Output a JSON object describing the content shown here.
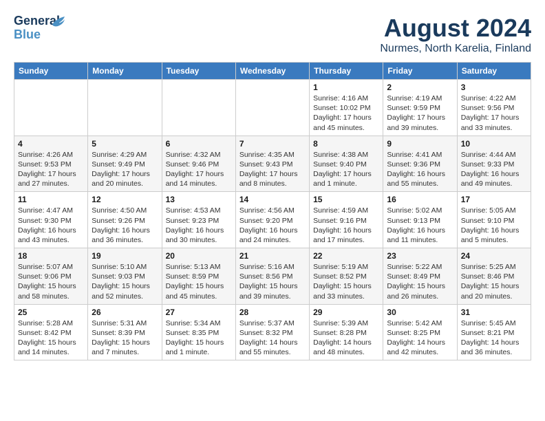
{
  "header": {
    "logo_line1": "General",
    "logo_line2": "Blue",
    "month_year": "August 2024",
    "location": "Nurmes, North Karelia, Finland"
  },
  "weekdays": [
    "Sunday",
    "Monday",
    "Tuesday",
    "Wednesday",
    "Thursday",
    "Friday",
    "Saturday"
  ],
  "weeks": [
    [
      {
        "day": "",
        "info": ""
      },
      {
        "day": "",
        "info": ""
      },
      {
        "day": "",
        "info": ""
      },
      {
        "day": "",
        "info": ""
      },
      {
        "day": "1",
        "info": "Sunrise: 4:16 AM\nSunset: 10:02 PM\nDaylight: 17 hours\nand 45 minutes."
      },
      {
        "day": "2",
        "info": "Sunrise: 4:19 AM\nSunset: 9:59 PM\nDaylight: 17 hours\nand 39 minutes."
      },
      {
        "day": "3",
        "info": "Sunrise: 4:22 AM\nSunset: 9:56 PM\nDaylight: 17 hours\nand 33 minutes."
      }
    ],
    [
      {
        "day": "4",
        "info": "Sunrise: 4:26 AM\nSunset: 9:53 PM\nDaylight: 17 hours\nand 27 minutes."
      },
      {
        "day": "5",
        "info": "Sunrise: 4:29 AM\nSunset: 9:49 PM\nDaylight: 17 hours\nand 20 minutes."
      },
      {
        "day": "6",
        "info": "Sunrise: 4:32 AM\nSunset: 9:46 PM\nDaylight: 17 hours\nand 14 minutes."
      },
      {
        "day": "7",
        "info": "Sunrise: 4:35 AM\nSunset: 9:43 PM\nDaylight: 17 hours\nand 8 minutes."
      },
      {
        "day": "8",
        "info": "Sunrise: 4:38 AM\nSunset: 9:40 PM\nDaylight: 17 hours\nand 1 minute."
      },
      {
        "day": "9",
        "info": "Sunrise: 4:41 AM\nSunset: 9:36 PM\nDaylight: 16 hours\nand 55 minutes."
      },
      {
        "day": "10",
        "info": "Sunrise: 4:44 AM\nSunset: 9:33 PM\nDaylight: 16 hours\nand 49 minutes."
      }
    ],
    [
      {
        "day": "11",
        "info": "Sunrise: 4:47 AM\nSunset: 9:30 PM\nDaylight: 16 hours\nand 43 minutes."
      },
      {
        "day": "12",
        "info": "Sunrise: 4:50 AM\nSunset: 9:26 PM\nDaylight: 16 hours\nand 36 minutes."
      },
      {
        "day": "13",
        "info": "Sunrise: 4:53 AM\nSunset: 9:23 PM\nDaylight: 16 hours\nand 30 minutes."
      },
      {
        "day": "14",
        "info": "Sunrise: 4:56 AM\nSunset: 9:20 PM\nDaylight: 16 hours\nand 24 minutes."
      },
      {
        "day": "15",
        "info": "Sunrise: 4:59 AM\nSunset: 9:16 PM\nDaylight: 16 hours\nand 17 minutes."
      },
      {
        "day": "16",
        "info": "Sunrise: 5:02 AM\nSunset: 9:13 PM\nDaylight: 16 hours\nand 11 minutes."
      },
      {
        "day": "17",
        "info": "Sunrise: 5:05 AM\nSunset: 9:10 PM\nDaylight: 16 hours\nand 5 minutes."
      }
    ],
    [
      {
        "day": "18",
        "info": "Sunrise: 5:07 AM\nSunset: 9:06 PM\nDaylight: 15 hours\nand 58 minutes."
      },
      {
        "day": "19",
        "info": "Sunrise: 5:10 AM\nSunset: 9:03 PM\nDaylight: 15 hours\nand 52 minutes."
      },
      {
        "day": "20",
        "info": "Sunrise: 5:13 AM\nSunset: 8:59 PM\nDaylight: 15 hours\nand 45 minutes."
      },
      {
        "day": "21",
        "info": "Sunrise: 5:16 AM\nSunset: 8:56 PM\nDaylight: 15 hours\nand 39 minutes."
      },
      {
        "day": "22",
        "info": "Sunrise: 5:19 AM\nSunset: 8:52 PM\nDaylight: 15 hours\nand 33 minutes."
      },
      {
        "day": "23",
        "info": "Sunrise: 5:22 AM\nSunset: 8:49 PM\nDaylight: 15 hours\nand 26 minutes."
      },
      {
        "day": "24",
        "info": "Sunrise: 5:25 AM\nSunset: 8:46 PM\nDaylight: 15 hours\nand 20 minutes."
      }
    ],
    [
      {
        "day": "25",
        "info": "Sunrise: 5:28 AM\nSunset: 8:42 PM\nDaylight: 15 hours\nand 14 minutes."
      },
      {
        "day": "26",
        "info": "Sunrise: 5:31 AM\nSunset: 8:39 PM\nDaylight: 15 hours\nand 7 minutes."
      },
      {
        "day": "27",
        "info": "Sunrise: 5:34 AM\nSunset: 8:35 PM\nDaylight: 15 hours\nand 1 minute."
      },
      {
        "day": "28",
        "info": "Sunrise: 5:37 AM\nSunset: 8:32 PM\nDaylight: 14 hours\nand 55 minutes."
      },
      {
        "day": "29",
        "info": "Sunrise: 5:39 AM\nSunset: 8:28 PM\nDaylight: 14 hours\nand 48 minutes."
      },
      {
        "day": "30",
        "info": "Sunrise: 5:42 AM\nSunset: 8:25 PM\nDaylight: 14 hours\nand 42 minutes."
      },
      {
        "day": "31",
        "info": "Sunrise: 5:45 AM\nSunset: 8:21 PM\nDaylight: 14 hours\nand 36 minutes."
      }
    ]
  ]
}
